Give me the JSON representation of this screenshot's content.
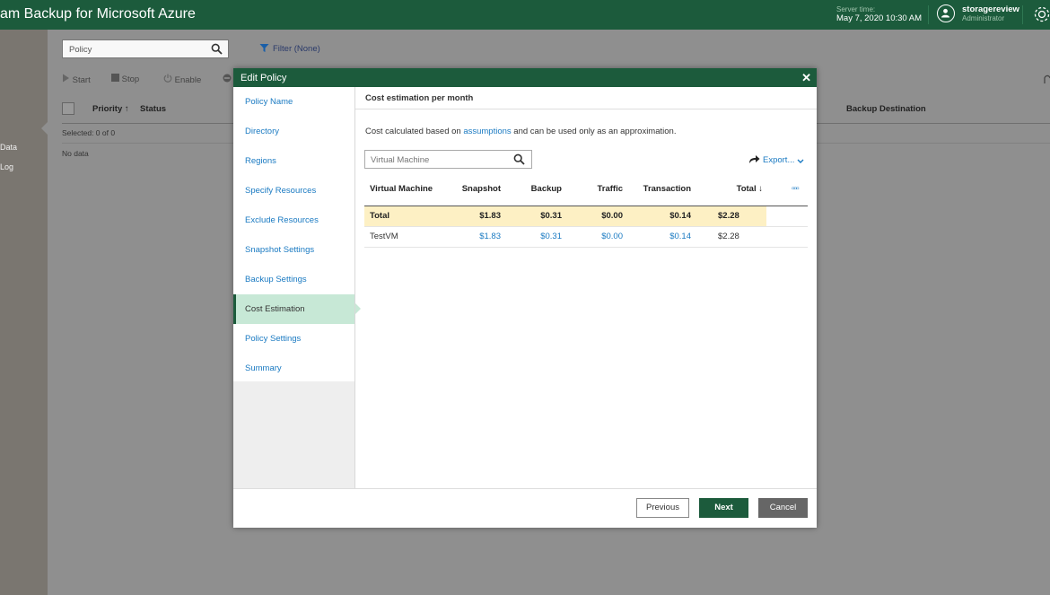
{
  "app": {
    "title": "am Backup for Microsoft Azure"
  },
  "server": {
    "label": "Server time:",
    "value": "May 7, 2020 10:30 AM"
  },
  "user": {
    "name": "storagereview",
    "role": "Administrator"
  },
  "left_nav": {
    "items": [
      "Data",
      "Log"
    ]
  },
  "background": {
    "search_value": "Policy",
    "filter_label": "Filter (None)",
    "toolbar": {
      "start": "Start",
      "stop": "Stop",
      "enable": "Enable"
    },
    "columns": {
      "priority": "Priority",
      "status": "Status",
      "backup_destination": "Backup Destination"
    },
    "selected": "Selected:  0 of 0",
    "no_data": "No data"
  },
  "dialog": {
    "title": "Edit Policy",
    "close": "✕",
    "steps": [
      "Policy Name",
      "Directory",
      "Regions",
      "Specify Resources",
      "Exclude Resources",
      "Snapshot Settings",
      "Backup Settings",
      "Cost Estimation",
      "Policy Settings",
      "Summary"
    ],
    "active_step": "Cost Estimation",
    "section_title": "Cost estimation per month",
    "desc_before": "Cost calculated based on ",
    "desc_link": "assumptions",
    "desc_after": " and can be used only as an approximation.",
    "search_placeholder": "Virtual Machine",
    "export_label": "Export...",
    "grid": {
      "headers": {
        "vm": "Virtual Machine",
        "snapshot": "Snapshot",
        "backup": "Backup",
        "traffic": "Traffic",
        "transaction": "Transaction",
        "total": "Total"
      },
      "total_row": {
        "vm": "Total",
        "snapshot": "$1.83",
        "backup": "$0.31",
        "traffic": "$0.00",
        "transaction": "$0.14",
        "total": "$2.28"
      },
      "rows": [
        {
          "vm": "TestVM",
          "snapshot": "$1.83",
          "backup": "$0.31",
          "traffic": "$0.00",
          "transaction": "$0.14",
          "total": "$2.28"
        }
      ]
    },
    "buttons": {
      "previous": "Previous",
      "next": "Next",
      "cancel": "Cancel"
    }
  },
  "colors": {
    "brand": "#1c5b3c",
    "link": "#1a7ac2",
    "active_step": "#c7e8d6",
    "total_row": "#fdf0c4"
  }
}
